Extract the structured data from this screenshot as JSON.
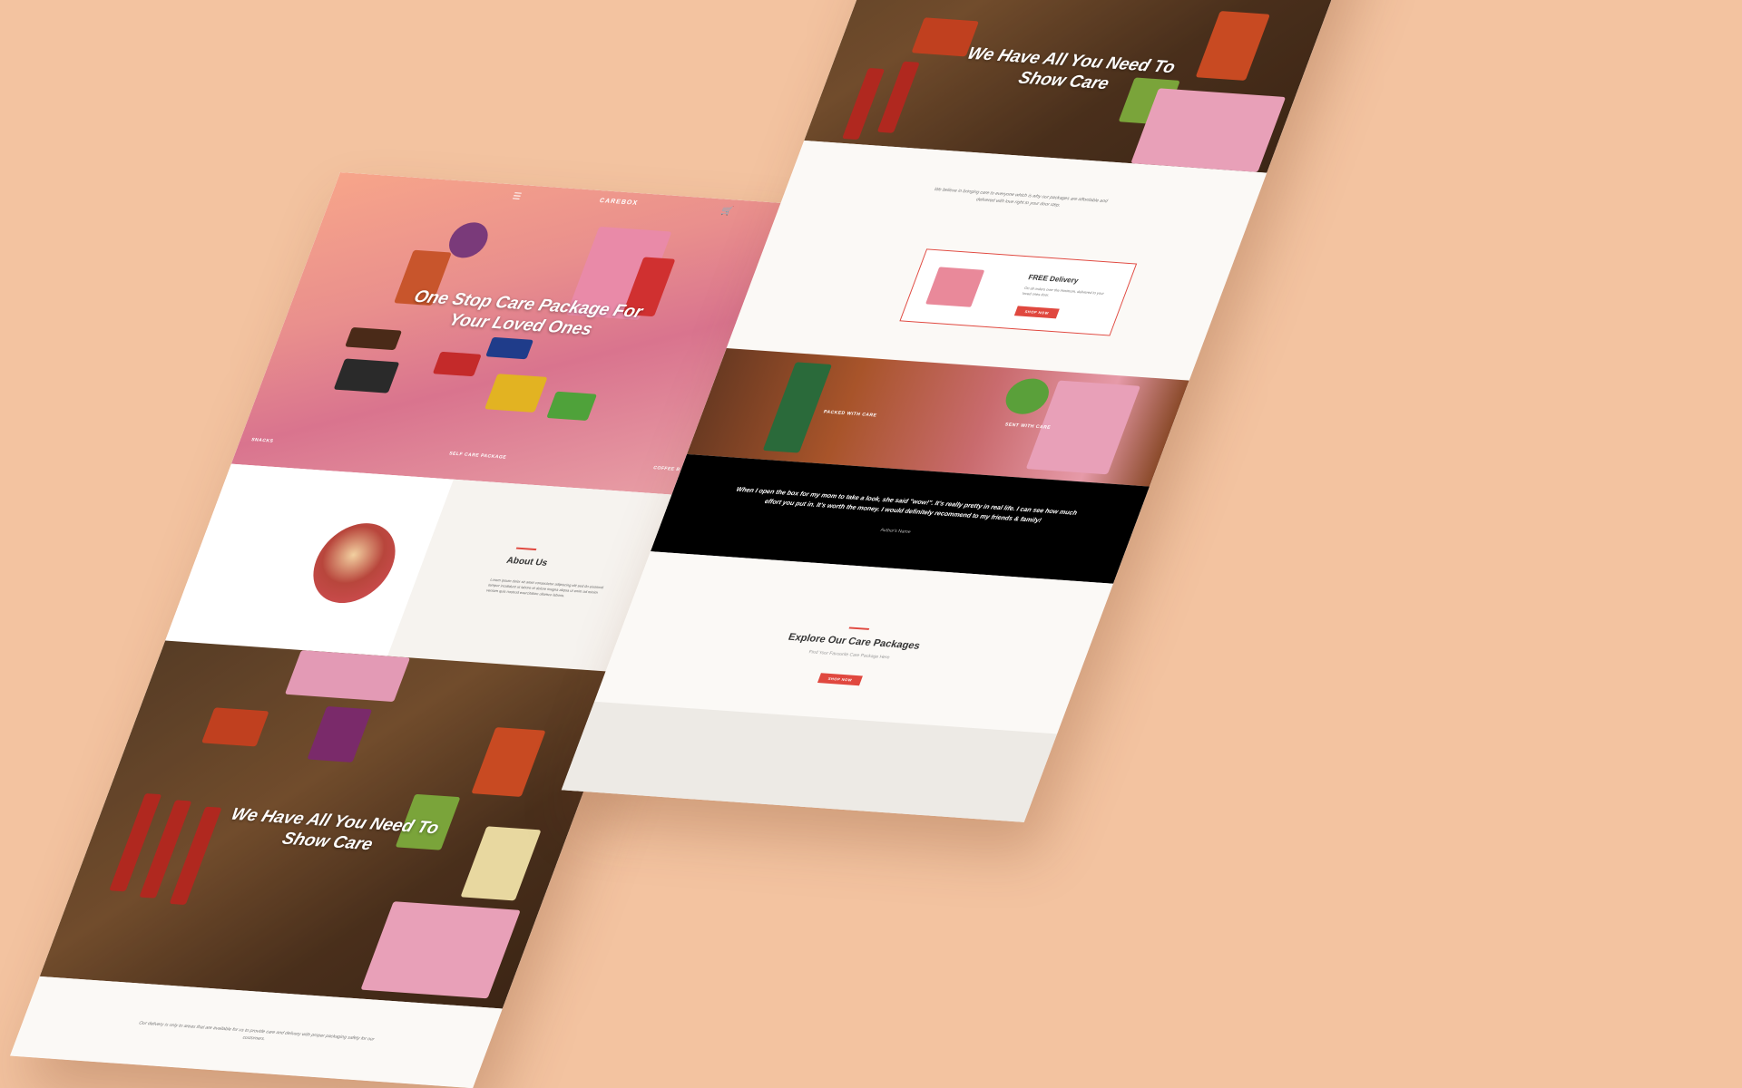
{
  "colors": {
    "background": "#F3C3A0",
    "accent": "#E0483F",
    "dark": "#000000",
    "cream": "#FBF9F6"
  },
  "left_page": {
    "nav": {
      "menu_icon": "hamburger-icon",
      "logo": "CAREBOX",
      "cart_icon": "bag-icon"
    },
    "hero": {
      "title_line1": "One Stop Care Package For",
      "title_line2": "Your Loved Ones",
      "cat_left": "SNACKS",
      "cat_mid": "SELF CARE PACKAGE",
      "cat_right": "COFFEE B"
    },
    "about": {
      "title": "About Us",
      "text": "Lorem ipsum dolor sit amet consectetur adipiscing elit sed do eiusmod tempor incididunt ut labore et dolore magna aliqua ut enim ad minim veniam quis nostrud exercitation ullamco laboris."
    },
    "feature": {
      "title_line1": "We Have All You Need To",
      "title_line2": "Show Care"
    },
    "footer": {
      "text": "Our delivery is only to areas that are available for us to provide care and delivery with proper packaging safety for our customers."
    }
  },
  "right_page": {
    "feature": {
      "title_line1": "We Have All You Need To",
      "title_line2": "Show Care"
    },
    "intro": {
      "text": "We believe in bringing care to everyone which is why our packages are affordable and delivered with love right to your door step."
    },
    "delivery": {
      "title": "FREE Delivery",
      "text": "On all orders over the minimum, delivered to your loved ones door.",
      "button": "SHOP NOW"
    },
    "banner": {
      "left_label": "PACKED WITH CARE",
      "right_label": "SENT WITH CARE"
    },
    "testimonial": {
      "quote": "When I open the box for my mom to take a look, she said \"wow!\". It's really pretty in real life. I can see how much effort you put in. It's worth the money. I would definitely recommend to my friends & family!",
      "author": "Author's Name"
    },
    "explore": {
      "title": "Explore Our Care Packages",
      "subtitle": "Find Your Favourite Care Package Here",
      "button": "SHOP NOW"
    }
  }
}
